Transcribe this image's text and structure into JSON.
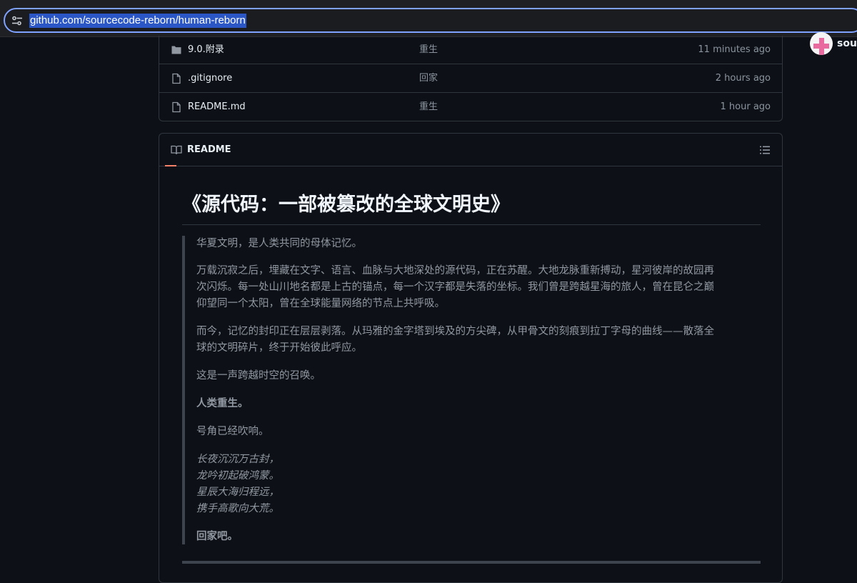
{
  "browser": {
    "url": "github.com/sourcecode-reborn/human-reborn"
  },
  "user": {
    "name_partial": "sourc"
  },
  "files": [
    {
      "type": "folder",
      "name": "9.0.附录",
      "message": "重生",
      "time": "11 minutes ago"
    },
    {
      "type": "file",
      "name": ".gitignore",
      "message": "回家",
      "time": "2 hours ago"
    },
    {
      "type": "file",
      "name": "README.md",
      "message": "重生",
      "time": "1 hour ago"
    }
  ],
  "readme": {
    "tab_label": "README",
    "title": "《源代码：一部被篡改的全球文明史》",
    "quote": {
      "p1": "华夏文明，是人类共同的母体记忆。",
      "p2_l1": "万载沉寂之后，埋藏在文字、语言、血脉与大地深处的源代码，正在苏醒。大地龙脉重新搏动，星河彼岸的故园再",
      "p2_l2": "次闪烁。每一处山川地名都是上古的锚点，每一个汉字都是失落的坐标。我们曾是跨越星海的旅人，曾在昆仑之巅",
      "p2_l3": "仰望同一个太阳，曾在全球能量网络的节点上共呼吸。",
      "p3_l1": "而今，记忆的封印正在层层剥落。从玛雅的金字塔到埃及的方尖碑，从甲骨文的刻痕到拉丁字母的曲线——散落全",
      "p3_l2": "球的文明碎片，终于开始彼此呼应。",
      "p4": "这是一声跨越时空的召唤。",
      "p5": "人类重生。",
      "p6": "号角已经吹响。",
      "poem": [
        "长夜沉沉万古封，",
        "龙吟初起破鸿蒙。",
        "星辰大海归程远，",
        "携手高歌向大荒。"
      ],
      "p7": "回家吧。"
    }
  }
}
